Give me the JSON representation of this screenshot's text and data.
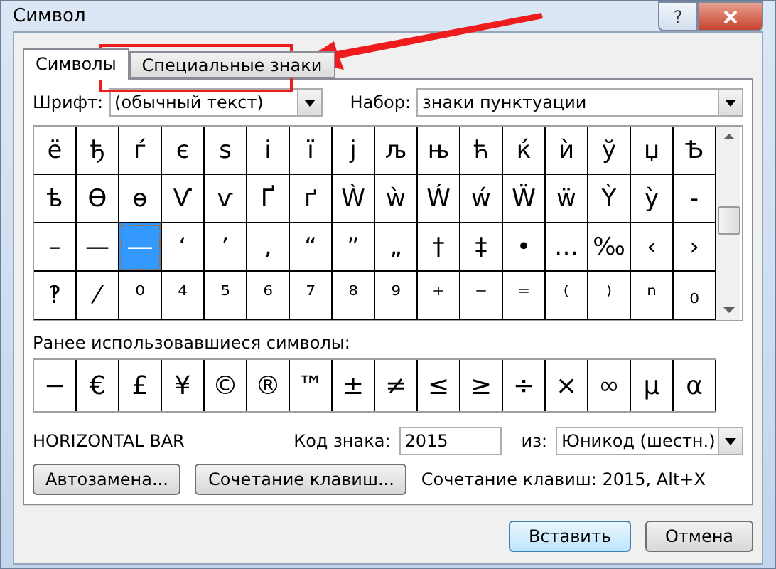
{
  "window": {
    "title": "Символ",
    "help": "?"
  },
  "tabs": [
    {
      "label": "Символы",
      "selected": true
    },
    {
      "label": "Специальные знаки",
      "selected": false
    }
  ],
  "font": {
    "label": "Шрифт:",
    "value": "(обычный текст)"
  },
  "subset": {
    "label": "Набор:",
    "value": "знаки пунктуации"
  },
  "grid": [
    [
      {
        "ch": "ё",
        "selected": false
      },
      {
        "ch": "ђ",
        "selected": false
      },
      {
        "ch": "ѓ",
        "selected": false
      },
      {
        "ch": "є",
        "selected": false
      },
      {
        "ch": "ѕ",
        "selected": false
      },
      {
        "ch": "і",
        "selected": false
      },
      {
        "ch": "ї",
        "selected": false
      },
      {
        "ch": "ј",
        "selected": false
      },
      {
        "ch": "љ",
        "selected": false
      },
      {
        "ch": "њ",
        "selected": false
      },
      {
        "ch": "ћ",
        "selected": false
      },
      {
        "ch": "ќ",
        "selected": false
      },
      {
        "ch": "ѝ",
        "selected": false
      },
      {
        "ch": "ў",
        "selected": false
      },
      {
        "ch": "џ",
        "selected": false
      },
      {
        "ch": "Ѣ",
        "selected": false
      }
    ],
    [
      {
        "ch": "ѣ",
        "selected": false
      },
      {
        "ch": "Ѳ",
        "selected": false
      },
      {
        "ch": "ѳ",
        "selected": false
      },
      {
        "ch": "Ѵ",
        "selected": false
      },
      {
        "ch": "ѵ",
        "selected": false
      },
      {
        "ch": "Ґ",
        "selected": false
      },
      {
        "ch": "ґ",
        "selected": false
      },
      {
        "ch": "Ẁ",
        "selected": false
      },
      {
        "ch": "ẁ",
        "selected": false
      },
      {
        "ch": "Ẃ",
        "selected": false
      },
      {
        "ch": "ẃ",
        "selected": false
      },
      {
        "ch": "Ẅ",
        "selected": false
      },
      {
        "ch": "ẅ",
        "selected": false
      },
      {
        "ch": "Ỳ",
        "selected": false
      },
      {
        "ch": "ỳ",
        "selected": false
      },
      {
        "ch": "‐",
        "selected": false
      }
    ],
    [
      {
        "ch": "–",
        "selected": false
      },
      {
        "ch": "—",
        "selected": false
      },
      {
        "ch": "―",
        "selected": true
      },
      {
        "ch": "‘",
        "selected": false
      },
      {
        "ch": "’",
        "selected": false
      },
      {
        "ch": "‚",
        "selected": false
      },
      {
        "ch": "“",
        "selected": false
      },
      {
        "ch": "”",
        "selected": false
      },
      {
        "ch": "„",
        "selected": false
      },
      {
        "ch": "†",
        "selected": false
      },
      {
        "ch": "‡",
        "selected": false
      },
      {
        "ch": "•",
        "selected": false
      },
      {
        "ch": "…",
        "selected": false
      },
      {
        "ch": "‰",
        "selected": false
      },
      {
        "ch": "‹",
        "selected": false
      },
      {
        "ch": "›",
        "selected": false
      }
    ],
    [
      {
        "ch": "‽",
        "selected": false
      },
      {
        "ch": "⁄",
        "selected": false
      },
      {
        "ch": "⁰",
        "selected": false
      },
      {
        "ch": "⁴",
        "selected": false
      },
      {
        "ch": "⁵",
        "selected": false
      },
      {
        "ch": "⁶",
        "selected": false
      },
      {
        "ch": "⁷",
        "selected": false
      },
      {
        "ch": "⁸",
        "selected": false
      },
      {
        "ch": "⁹",
        "selected": false
      },
      {
        "ch": "⁺",
        "selected": false
      },
      {
        "ch": "⁻",
        "selected": false
      },
      {
        "ch": "⁼",
        "selected": false
      },
      {
        "ch": "⁽",
        "selected": false
      },
      {
        "ch": "⁾",
        "selected": false
      },
      {
        "ch": "ⁿ",
        "selected": false
      },
      {
        "ch": "₀",
        "selected": false
      }
    ]
  ],
  "recent": {
    "label": "Ранее использовавшиеся символы:",
    "symbols": [
      "−",
      "€",
      "£",
      "¥",
      "©",
      "®",
      "™",
      "±",
      "≠",
      "≤",
      "≥",
      "÷",
      "×",
      "∞",
      "µ",
      "α"
    ]
  },
  "char_name": "HORIZONTAL BAR",
  "code": {
    "label": "Код знака:",
    "value": "2015"
  },
  "from": {
    "label": "из:",
    "value": "Юникод (шестн.)"
  },
  "autocorrect_button": "Автозамена...",
  "shortcut_button": "Сочетание клавиш...",
  "shortcut_text": "Сочетание клавиш: 2015, Alt+X",
  "insert_button": "Вставить",
  "cancel_button": "Отмена"
}
